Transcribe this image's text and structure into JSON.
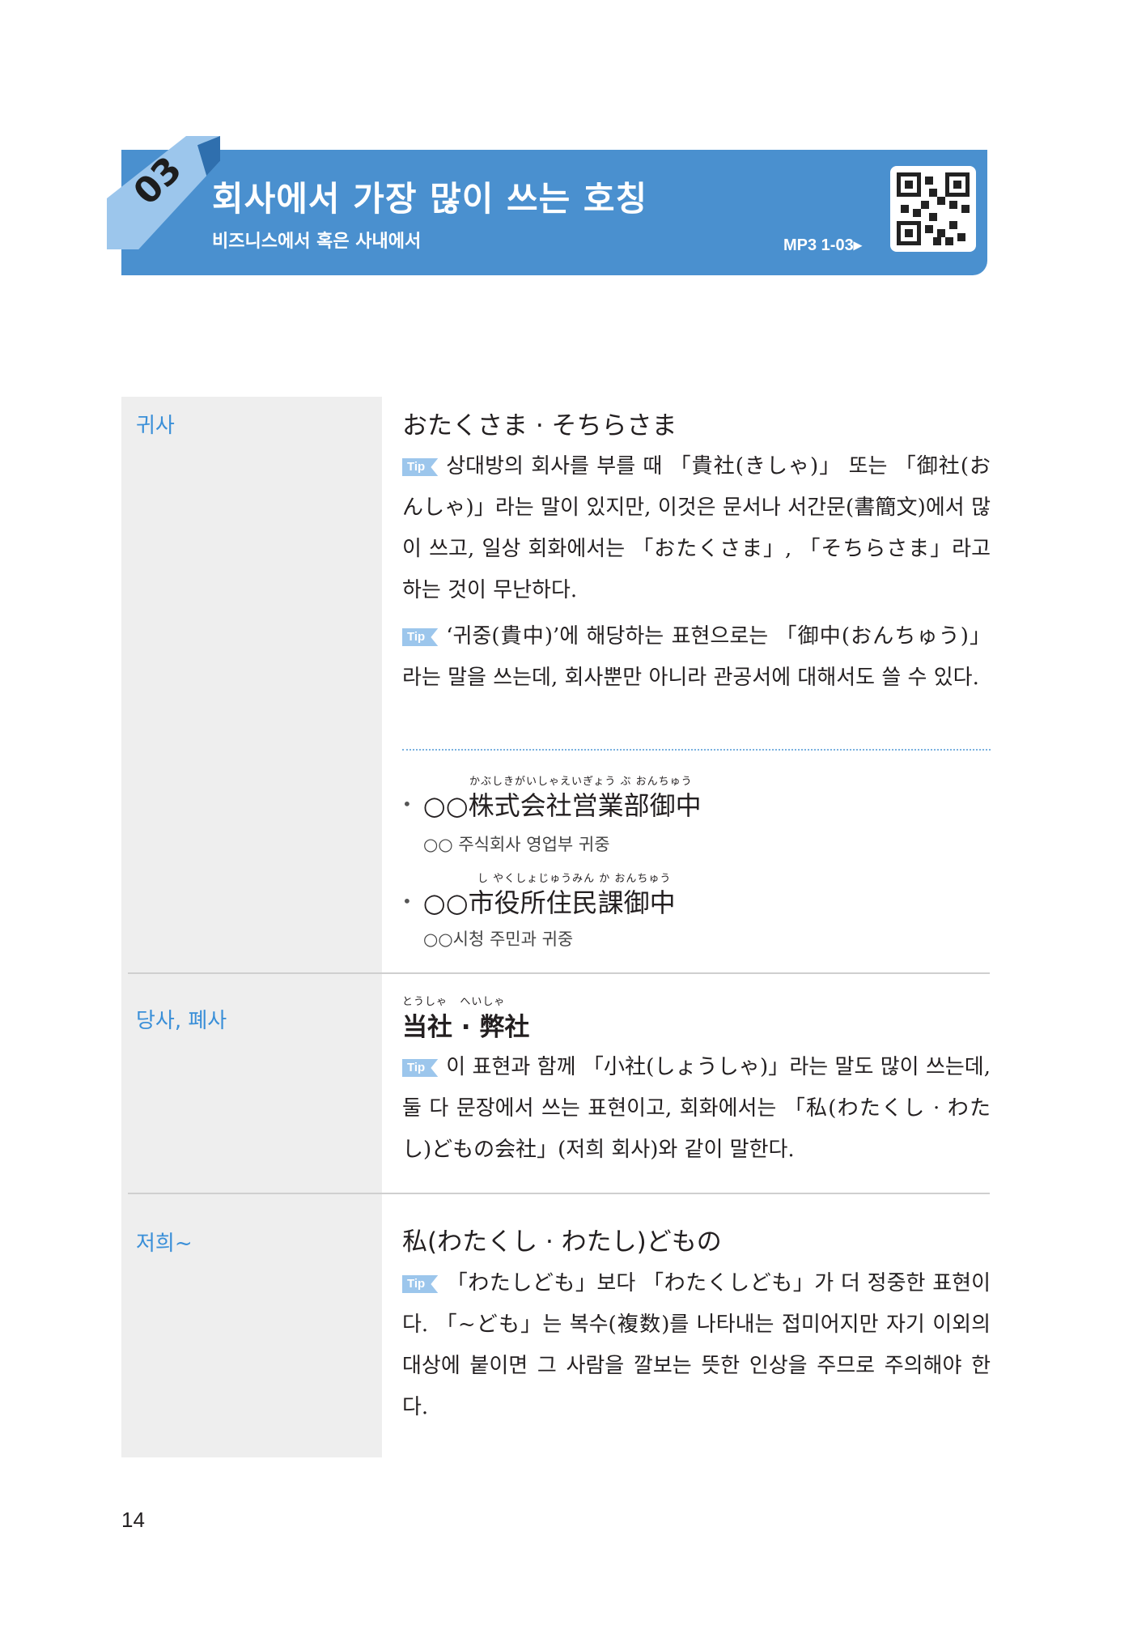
{
  "header": {
    "section_number": "03",
    "title": "회사에서 가장 많이 쓰는 호칭",
    "subtitle": "비즈니스에서 혹은 사내에서",
    "mp3_label": "MP3 1-03▸"
  },
  "rows": [
    {
      "label": "귀사",
      "heading": "おたくさま · そちらさま",
      "tip_label": "Tip",
      "tips": [
        "상대방의 회사를 부를 때 「貴社(きしゃ)」 또는 「御社(おんしゃ)」라는 말이 있지만, 이것은 문서나 서간문(書簡文)에서 많이 쓰고, 일상 회화에서는 「おたくさま」, 「そちらさま」라고 하는 것이 무난하다.",
        "‘귀중(貴中)’에 해당하는 표현으로는 「御中(おんちゅう)」라는 말을 쓰는데, 회사뿐만 아니라 관공서에 대해서도 쓸 수 있다."
      ],
      "examples": [
        {
          "ruby": "かぶしきがいしゃえいぎょう ぶ おんちゅう",
          "text": "○○株式会社営業部御中",
          "translation": "○○ 주식회사 영업부 귀중"
        },
        {
          "ruby": "し やくしょじゅうみん か おんちゅう",
          "text": "○○市役所住民課御中",
          "translation": "○○시청 주민과 귀중"
        }
      ]
    },
    {
      "label": "당사, 폐사",
      "heading_ruby": "とうしゃ   へいしゃ",
      "heading": "当社 · 弊社",
      "tip_label": "Tip",
      "tips": [
        "이 표현과 함께 「小社(しょうしゃ)」라는 말도 많이 쓰는데, 둘 다 문장에서 쓰는 표현이고, 회화에서는 「私(わたくし · わたし)どもの会社」(저희 회사)와 같이 말한다."
      ]
    },
    {
      "label": "저희~",
      "heading": "私(わたくし · わたし)どもの",
      "tip_label": "Tip",
      "tips": [
        "「わたしども」보다 「わたくしども」가 더 정중한 표현이다. 「~ども」는 복수(複数)를 나타내는 접미어지만 자기 이외의 대상에 붙이면 그 사람을 깔보는 뜻한 인상을 주므로 주의해야 한다."
      ]
    }
  ],
  "page_number": "14",
  "colors": {
    "banner": "#4a90cf",
    "accent_light": "#9cc6ec",
    "label_blue": "#3a8fd8",
    "left_column": "#eeeeee"
  }
}
